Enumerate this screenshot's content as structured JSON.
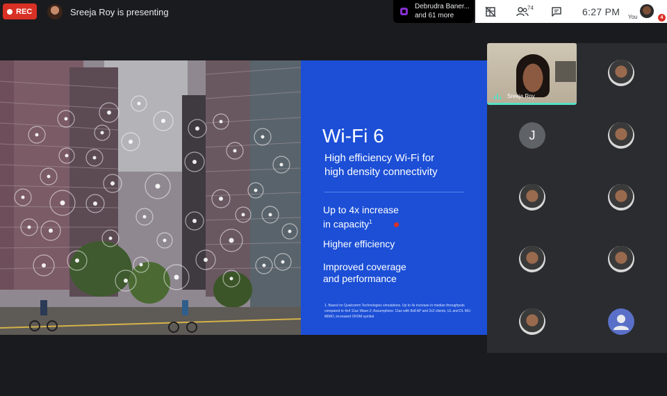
{
  "topbar": {
    "rec_label": "REC",
    "presenter_text": "Sreeja Roy is presenting",
    "presentation_tile": {
      "line1": "Debrudra Baner...",
      "line2": "and 61 more"
    },
    "people_badge": "74",
    "clock": "6:27  PM",
    "you_label": "You",
    "you_badge": "4"
  },
  "slide": {
    "title": "Wi-Fi 6",
    "subtitle": "High efficiency Wi-Fi for\nhigh density connectivity",
    "bullets": [
      {
        "text": "Up to 4x increase\nin capacity",
        "sup": "1"
      },
      {
        "text": "Higher efficiency"
      },
      {
        "text": "Improved coverage\nand performance"
      }
    ],
    "footnote": "1. Based on Qualcomm Technologies simulations. Up to 4x increase in median throughputs compared to 4x4 11ac Wave-2; Assumptions: 11ax with 8x8 AP and 2x2 clients, UL and DL MU-MIMO, increased OFDM symbol",
    "colors": {
      "panel": "#1c4fd6",
      "rule": "#5b82ea"
    }
  },
  "participants": {
    "speaker": {
      "name": "Sreeja Roy",
      "highlight_color": "#56e0c6"
    },
    "tiles": [
      {
        "type": "photo"
      },
      {
        "type": "letter",
        "letter": "J"
      },
      {
        "type": "photo"
      },
      {
        "type": "photo"
      },
      {
        "type": "photo"
      },
      {
        "type": "photo"
      },
      {
        "type": "photo"
      },
      {
        "type": "photo"
      },
      {
        "type": "photo"
      },
      {
        "type": "generic-avatar"
      }
    ]
  },
  "icons": [
    "grid-off-icon",
    "people-icon",
    "chat-icon",
    "present-icon",
    "audio-bars-icon"
  ]
}
